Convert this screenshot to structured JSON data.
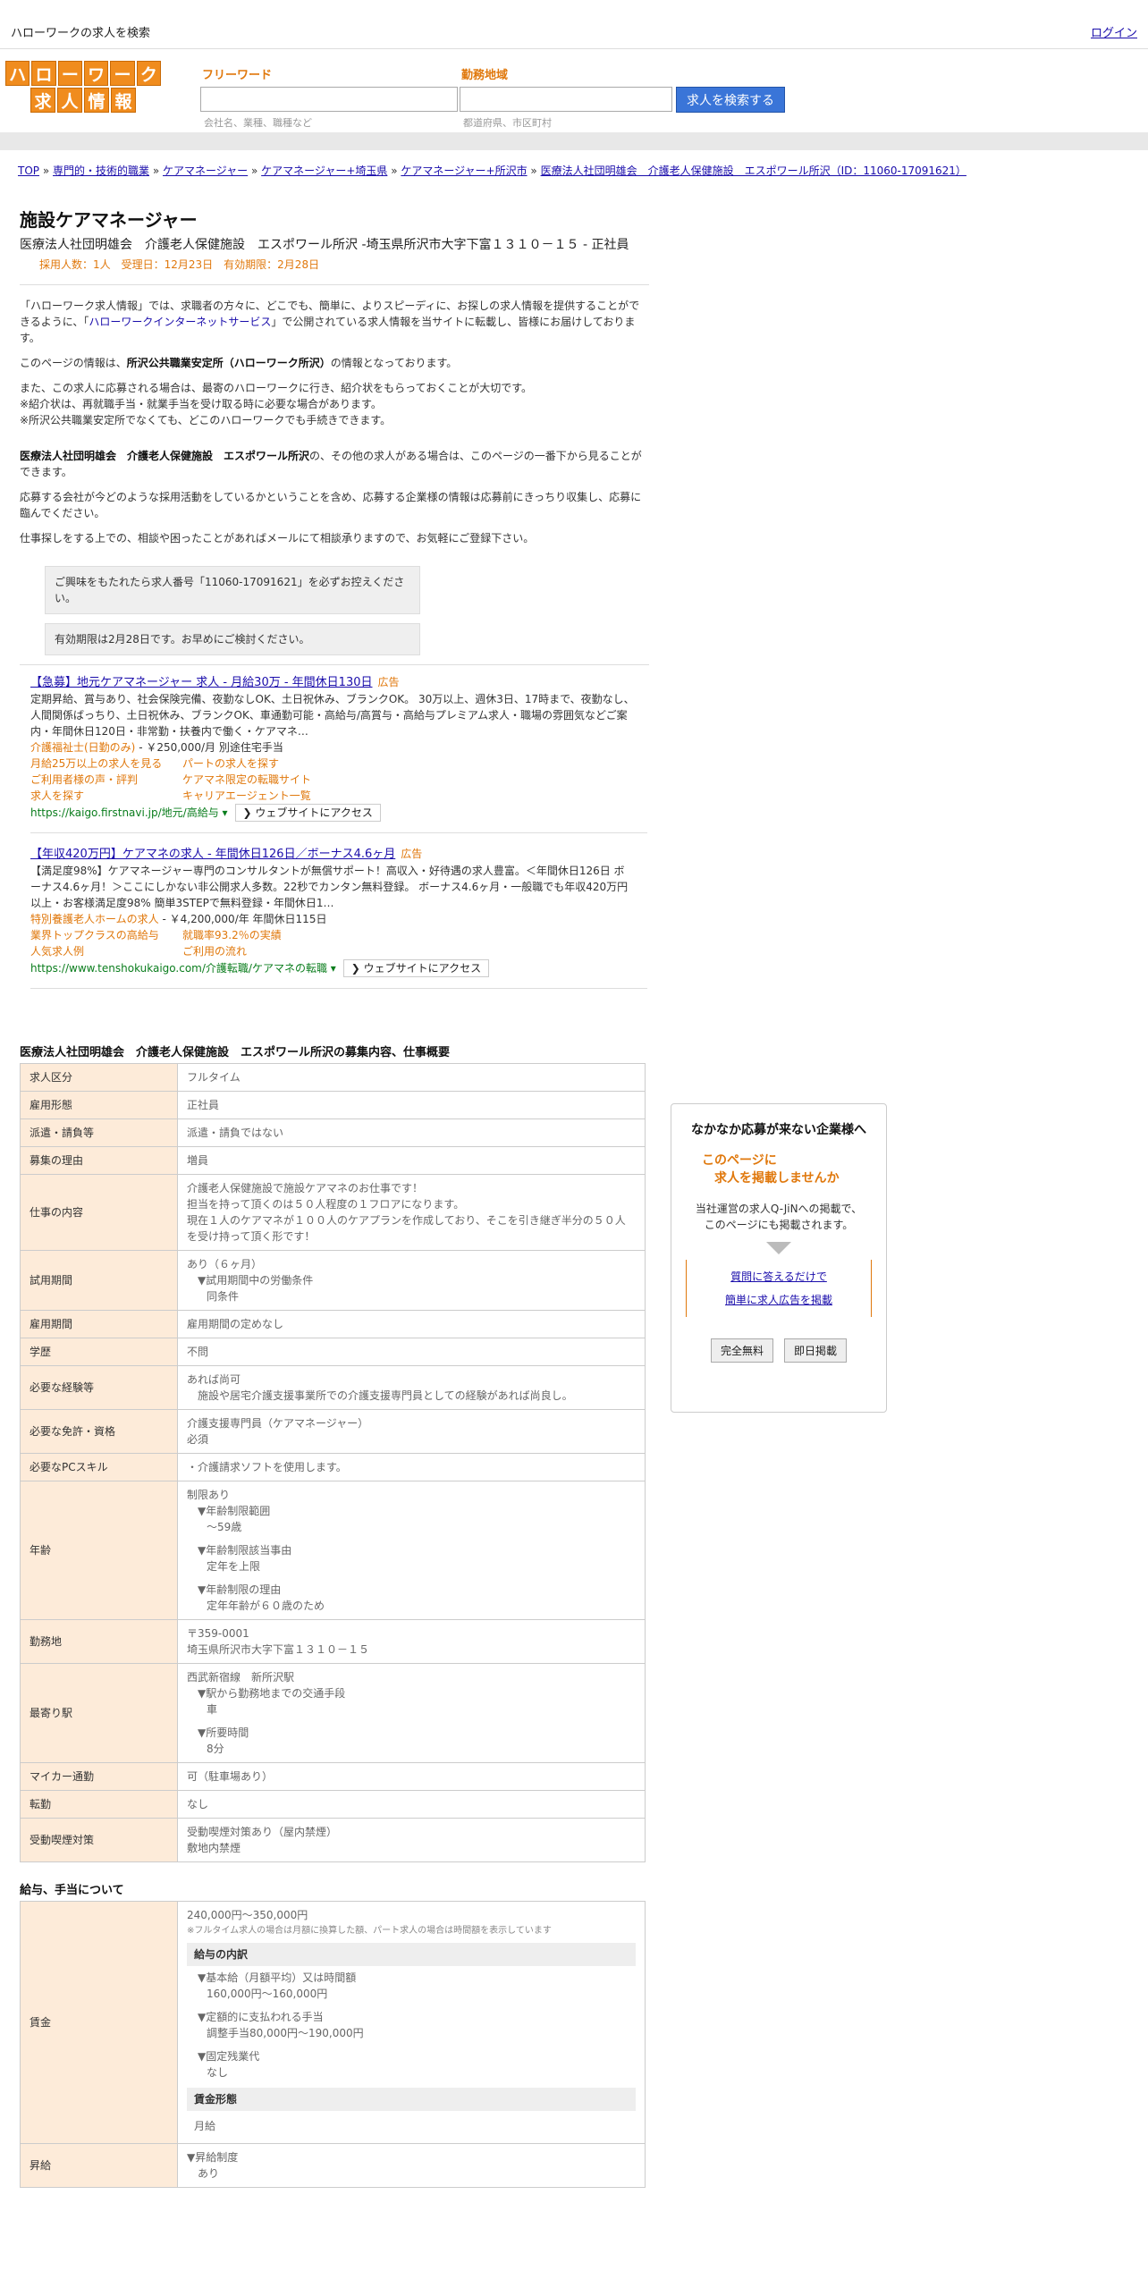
{
  "topbar": {
    "title": "ハローワークの求人を検索",
    "login": "ログイン"
  },
  "logo": {
    "row1": [
      "ハ",
      "ロ",
      "ー",
      "ワ",
      "ー",
      "ク"
    ],
    "row2": [
      "求",
      "人",
      "情",
      "報"
    ]
  },
  "search": {
    "keyword_label": "フリーワード",
    "keyword_placeholder": "会社名、業種、職種など",
    "area_label": "勤務地域",
    "area_placeholder": "都道府県、市区町村",
    "button": "求人を検索する"
  },
  "breadcrumb": {
    "items": [
      "TOP",
      "専門的・技術的職業",
      "ケアマネージャー",
      "ケアマネージャー+埼玉県",
      "ケアマネージャー+所沢市",
      "医療法人社団明雄会　介護老人保健施設　エスポワール所沢（ID：11060-17091621）"
    ],
    "sep": "»"
  },
  "job": {
    "title": "施設ケアマネージャー",
    "subtitle": "医療法人社団明雄会　介護老人保健施設　エスポワール所沢 -埼玉県所沢市大字下富１３１０－１５ - 正社員",
    "meta": "採用人数：1人　受理日：12月23日　有効期限：2月28日"
  },
  "intro": {
    "p1a": "「ハローワーク求人情報」では、求職者の方々に、どこでも、簡単に、よりスピーディに、お探しの求人情報を提供することができるように、「",
    "p1link": "ハローワークインターネットサービス",
    "p1b": "」で公開されている求人情報を当サイトに転載し、皆様にお届けしております。",
    "p2a": "このページの情報は、",
    "p2b": "所沢公共職業安定所（ハローワーク所沢）",
    "p2c": "の情報となっております。",
    "p3_1": "また、この求人に応募される場合は、最寄のハローワークに行き、紹介状をもらっておくことが大切です。",
    "p3_2": "※紹介状は、再就職手当・就業手当を受け取る時に必要な場合があります。",
    "p3_3": "※所沢公共職業安定所でなくても、どこのハローワークでも手続きできます。",
    "p4a": "医療法人社団明雄会　介護老人保健施設　エスポワール所沢",
    "p4b": "の、その他の求人がある場合は、このページの一番下から見ることができます。",
    "p5": "応募する会社が今どのような採用活動をしているかということを含め、応募する企業様の情報は応募前にきっちり収集し、応募に臨んでください。",
    "p6": "仕事探しをする上での、相談や困ったことがあればメールにて相談承りますので、お気軽にご登録下さい。",
    "note1": "ご興味をもたれたら求人番号「11060-17091621」を必ずお控えください。",
    "note2": "有効期限は2月28日です。お早めにご検討ください。"
  },
  "ads": [
    {
      "title": "【急募】地元ケアマネージャー 求人 - 月給30万 - 年間休日130日",
      "tag": "広告",
      "desc": "定期昇給、賞与あり、社会保険完備、夜勤なしOK、土日祝休み、ブランクOK。 30万以上、週休3日、17時まで、夜勤なし、人間関係ばっちり、土日祝休み、ブランクOK、車通勤可能・高給与/高賞与・高給与プレミアム求人・職場の雰囲気などご案内・年間休日120日・非常勤・扶養内で働く・ケアマネ…",
      "sublead": "介護福祉士(日勤のみ)",
      "subrest": " - ￥250,000/月 別途住宅手当",
      "links": [
        "月給25万以上の求人を見る",
        "パートの求人を探す",
        "ご利用者様の声・評判",
        "ケアマネ限定の転職サイト",
        "求人を探す",
        "キャリアエージェント一覧"
      ],
      "url": "https://kaigo.firstnavi.jp/地元/高給与 ▾",
      "visit": "❯ ウェブサイトにアクセス"
    },
    {
      "title": "【年収420万円】ケアマネの求人 - 年間休日126日／ボーナス4.6ヶ月",
      "tag": "広告",
      "desc": "【満足度98%】ケアマネージャー専門のコンサルタントが無償サポート！高収入・好待遇の求人豊富。＜年間休日126日 ボーナス4.6ヶ月！＞ここにしかない非公開求人多数。22秒でカンタン無料登録。 ボーナス4.6ヶ月・一般職でも年収420万円以上・お客様満足度98% 簡単3STEPで無料登録・年間休日1…",
      "sublead": "特別養護老人ホームの求人",
      "subrest": " - ￥4,200,000/年 年間休日115日",
      "links": [
        "業界トップクラスの高給与",
        "就職率93.2％の実績",
        "人気求人例",
        "ご利用の流れ"
      ],
      "url": "https://www.tenshokukaigo.com/介護転職/ケアマネの転職 ▾",
      "visit": "❯ ウェブサイトにアクセス"
    }
  ],
  "detail": {
    "heading": "医療法人社団明雄会　介護老人保健施設　エスポワール所沢の募集内容、仕事概要",
    "rows": [
      {
        "k": "求人区分",
        "v": [
          "フルタイム"
        ]
      },
      {
        "k": "雇用形態",
        "v": [
          "正社員"
        ]
      },
      {
        "k": "派遣・請負等",
        "v": [
          "派遣・請負ではない"
        ]
      },
      {
        "k": "募集の理由",
        "v": [
          "増員"
        ]
      },
      {
        "k": "仕事の内容",
        "v": [
          "介護老人保健施設で施設ケアマネのお仕事です！",
          "担当を持って頂くのは５０人程度の１フロアになります。",
          "現在１人のケアマネが１００人のケアプランを作成しており、そこを引き継ぎ半分の５０人を受け持って頂く形です！"
        ]
      },
      {
        "k": "試用期間",
        "v": [
          "あり（６ヶ月）",
          "▼試用期間中の労働条件",
          "同条件"
        ],
        "fmt": [
          "",
          "ind",
          "ind2"
        ]
      },
      {
        "k": "雇用期間",
        "v": [
          "雇用期間の定めなし"
        ]
      },
      {
        "k": "学歴",
        "v": [
          "不問"
        ]
      },
      {
        "k": "必要な経験等",
        "v": [
          "あれば尚可",
          "施設や居宅介護支援事業所での介護支援専門員としての経験があれば尚良し。"
        ],
        "fmt": [
          "",
          "ind"
        ]
      },
      {
        "k": "必要な免許・資格",
        "v": [
          "介護支援専門員（ケアマネージャー）",
          "必須"
        ]
      },
      {
        "k": "必要なPCスキル",
        "v": [
          "・介護請求ソフトを使用します。"
        ]
      },
      {
        "k": "年齢",
        "v": [
          "制限あり",
          "▼年齢制限範囲",
          "〜59歳",
          "▼年齢制限該当事由",
          "定年を上限",
          "▼年齢制限の理由",
          "定年年齢が６０歳のため"
        ],
        "fmt": [
          "",
          "ind",
          "ind2",
          "ind",
          "ind2",
          "ind",
          "ind2"
        ]
      },
      {
        "k": "勤務地",
        "v": [
          "〒359-0001",
          "埼玉県所沢市大字下富１３１０－１５"
        ]
      },
      {
        "k": "最寄り駅",
        "v": [
          "西武新宿線　新所沢駅",
          "▼駅から勤務地までの交通手段",
          "車",
          "▼所要時間",
          "8分"
        ],
        "fmt": [
          "",
          "ind",
          "ind2",
          "ind",
          "ind2"
        ]
      },
      {
        "k": "マイカー通勤",
        "v": [
          "可（駐車場あり）"
        ]
      },
      {
        "k": "転勤",
        "v": [
          "なし"
        ]
      },
      {
        "k": "受動喫煙対策",
        "v": [
          "受動喫煙対策あり（屋内禁煙）",
          "敷地内禁煙"
        ]
      }
    ]
  },
  "salary": {
    "heading": "給与、手当について",
    "wage_label": "賃金",
    "wage_range": "240,000円〜350,000円",
    "wage_note": "※フルタイム求人の場合は月額に換算した額、パート求人の場合は時間額を表示しています",
    "breakdown_h": "給与の内訳",
    "b1": "▼基本給（月額平均）又は時間額",
    "b1v": "160,000円〜160,000円",
    "b2": "▼定額的に支払われる手当",
    "b2v": "調整手当80,000円〜190,000円",
    "b3": "▼固定残業代",
    "b3v": "なし",
    "form_h": "賃金形態",
    "form_v": "月給",
    "raise_label": "昇給",
    "raise1": "▼昇給制度",
    "raise1v": "あり"
  },
  "side": {
    "heading": "なかなか応募が来ない企業様へ",
    "orange1": "このページに",
    "orange2": "求人を掲載しませんか",
    "body1": "当社運営の求人Q-JiNへの掲載で、",
    "body2": "このページにも掲載されます。",
    "link1": "質問に答えるだけで",
    "link2": "簡単に求人広告を掲載",
    "btn1": "完全無料",
    "btn2": "即日掲載"
  }
}
